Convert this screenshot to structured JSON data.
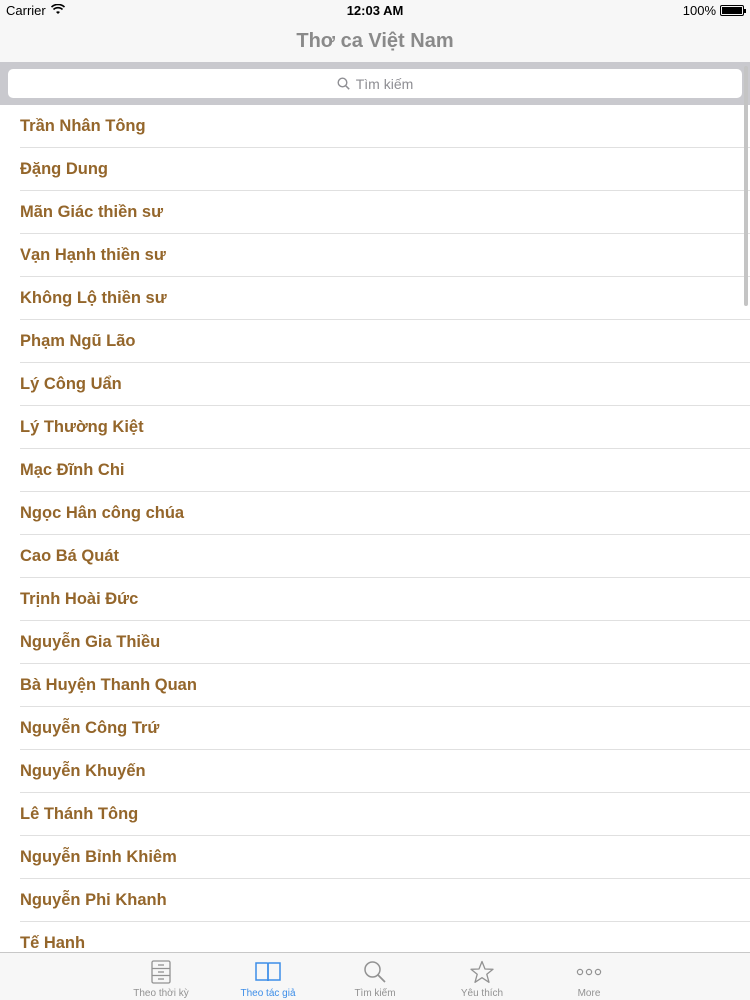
{
  "status_bar": {
    "carrier": "Carrier",
    "time": "12:03 AM",
    "battery": "100%"
  },
  "nav": {
    "title": "Thơ ca Việt Nam"
  },
  "search": {
    "placeholder": "Tìm kiếm"
  },
  "authors": [
    "Trần Nhân Tông",
    "Đặng Dung",
    "Mãn Giác thiền sư",
    "Vạn Hạnh thiền sư",
    "Không Lộ thiền sư",
    "Phạm Ngũ Lão",
    "Lý Công Uẩn",
    "Lý Thường Kiệt",
    "Mạc Đĩnh Chi",
    "Ngọc Hân công chúa",
    "Cao Bá Quát",
    "Trịnh Hoài Đức",
    "Nguyễn Gia Thiều",
    "Bà Huyện Thanh Quan",
    "Nguyễn Công Trứ",
    "Nguyễn Khuyến",
    "Lê Thánh Tông",
    "Nguyễn Bỉnh Khiêm",
    "Nguyễn Phi Khanh",
    "Tế Hanh"
  ],
  "tabs": [
    {
      "label": "Theo thời kỳ",
      "icon": "cabinet-icon",
      "active": false
    },
    {
      "label": "Theo tác giả",
      "icon": "book-icon",
      "active": true
    },
    {
      "label": "Tìm kiếm",
      "icon": "search-icon",
      "active": false
    },
    {
      "label": "Yêu thích",
      "icon": "star-icon",
      "active": false
    },
    {
      "label": "More",
      "icon": "more-icon",
      "active": false
    }
  ],
  "colors": {
    "author_text": "#94662b",
    "tab_active": "#3d8ee8",
    "tab_inactive": "#929292"
  }
}
